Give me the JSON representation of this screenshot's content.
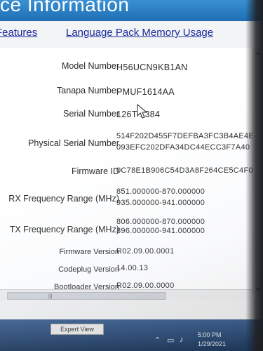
{
  "window": {
    "title": "ce Information"
  },
  "tabs": [
    {
      "label": "Features"
    },
    {
      "label": "Language Pack Memory Usage"
    }
  ],
  "fields": {
    "model_number": {
      "label": "Model Number",
      "value": "H56UCN9KB1AN"
    },
    "tanapa_number": {
      "label": "Tanapa Number",
      "value": "PMUF1614AA"
    },
    "serial_number": {
      "label": "Serial Number",
      "value": "126T  1384"
    },
    "physical_serial": {
      "label": "Physical Serial Number",
      "value_line1": "514F202D455F7DEFBA3FC3B4AE4E",
      "value_line2": "093EFC202DFA34DC44ECC3F7A40"
    },
    "firmware_id": {
      "label": "Firmware ID",
      "value": "0C78E1B906C54D3A8F264CE5C4F0"
    },
    "rx_frequency": {
      "label": "RX Frequency Range (MHz)",
      "value_line1": "851.000000-870.000000",
      "value_line2": "935.000000-941.000000"
    },
    "tx_frequency": {
      "label": "TX Frequency Range (MHz)",
      "value_line1": "806.000000-870.000000",
      "value_line2": "896.000000-941.000000"
    },
    "firmware_version": {
      "label": "Firmware Version",
      "value": "R02.09.00.0001"
    },
    "codeplug_version": {
      "label": "Codeplug Version",
      "value": "14.00.13"
    },
    "bootloader_version": {
      "label": "Bootloader Version",
      "value": "R02.09.00.0000"
    }
  },
  "buttons": {
    "expert_view": "Expert View"
  },
  "taskbar": {
    "time": "5:00 PM",
    "date": "1/29/2021",
    "icons": [
      "chevron-up-icon",
      "network-icon",
      "speaker-icon",
      "battery-icon"
    ]
  },
  "colors": {
    "title_bar": "#1f6fb3",
    "link": "#1a2a9a",
    "taskbar": "#25466f"
  }
}
